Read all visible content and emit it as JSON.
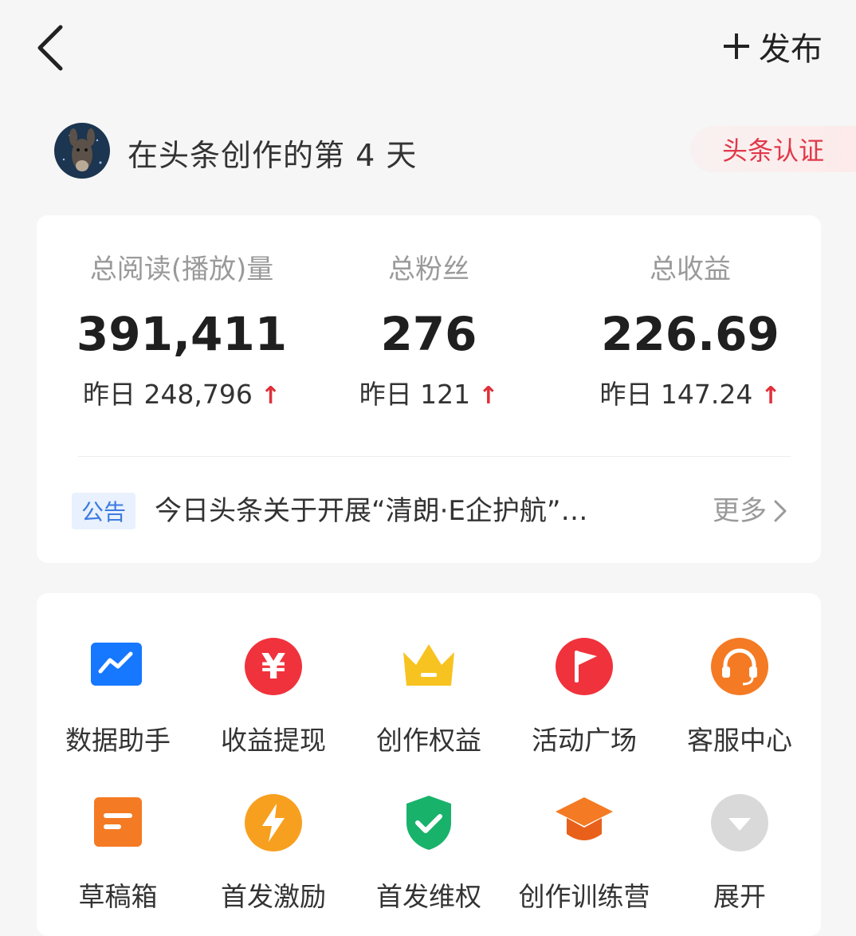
{
  "header": {
    "publish_label": "发布"
  },
  "profile": {
    "status_text": "在头条创作的第 4 天",
    "badge": "头条认证"
  },
  "stats": [
    {
      "label": "总阅读(播放)量",
      "value": "391,411",
      "yesterday": "昨日 248,796"
    },
    {
      "label": "总粉丝",
      "value": "276",
      "yesterday": "昨日 121"
    },
    {
      "label": "总收益",
      "value": "226.69",
      "yesterday": "昨日 147.24"
    }
  ],
  "notice": {
    "tag": "公告",
    "text": "今日头条关于开展“清朗·E企护航”…",
    "more": "更多"
  },
  "tools": [
    {
      "label": "数据助手",
      "icon": "chart-icon",
      "color": "#1677ff"
    },
    {
      "label": "收益提现",
      "icon": "yuan-icon",
      "color": "#f0323c"
    },
    {
      "label": "创作权益",
      "icon": "crown-icon",
      "color": "#f7c320"
    },
    {
      "label": "活动广场",
      "icon": "flag-icon",
      "color": "#f0323c"
    },
    {
      "label": "客服中心",
      "icon": "headset-icon",
      "color": "#f47a23"
    },
    {
      "label": "草稿箱",
      "icon": "draft-icon",
      "color": "#f47a23"
    },
    {
      "label": "首发激励",
      "icon": "lightning-icon",
      "color": "#f7a020"
    },
    {
      "label": "首发维权",
      "icon": "shield-check-icon",
      "color": "#19b26b"
    },
    {
      "label": "创作训练营",
      "icon": "graduation-cap-icon",
      "color": "#f47a23"
    },
    {
      "label": "展开",
      "icon": "expand-icon",
      "color": "#d9d9d9"
    }
  ]
}
